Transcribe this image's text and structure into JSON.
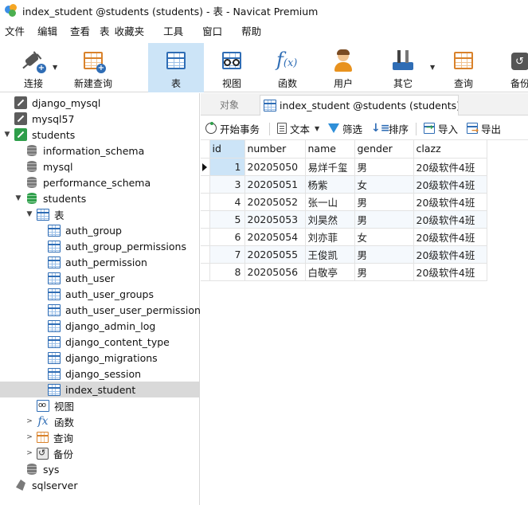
{
  "window": {
    "title": "index_student @students (students) - 表 - Navicat Premium"
  },
  "menu": [
    "文件",
    "编辑",
    "查看",
    "表",
    "收藏夹",
    "工具",
    "窗口",
    "帮助"
  ],
  "toolbar": {
    "connect": "连接",
    "new_query": "新建查询",
    "table": "表",
    "view": "视图",
    "function": "函数",
    "user": "用户",
    "other": "其它",
    "query": "查询",
    "backup": "备份"
  },
  "tree": {
    "connections": [
      "django_mysql",
      "mysql57",
      "students"
    ],
    "databases": [
      "information_schema",
      "mysql",
      "performance_schema",
      "students"
    ],
    "tables_label": "表",
    "tables": [
      "auth_group",
      "auth_group_permissions",
      "auth_permission",
      "auth_user",
      "auth_user_groups",
      "auth_user_user_permissions",
      "django_admin_log",
      "django_content_type",
      "django_migrations",
      "django_session",
      "index_student"
    ],
    "view_label": "视图",
    "function_label": "函数",
    "query_label": "查询",
    "backup_label": "备份",
    "sys": "sys",
    "sqlserver": "sqlserver"
  },
  "tabs": {
    "objects": "对象",
    "active": "index_student @students (students) ..."
  },
  "subtoolbar": {
    "begin_tx": "开始事务",
    "text": "文本",
    "filter": "筛选",
    "sort": "排序",
    "import": "导入",
    "export": "导出"
  },
  "grid": {
    "columns": [
      "id",
      "number",
      "name",
      "gender",
      "clazz"
    ],
    "rows": [
      [
        "1",
        "20205050",
        "易烊千玺",
        "男",
        "20级软件4班"
      ],
      [
        "3",
        "20205051",
        "杨紫",
        "女",
        "20级软件4班"
      ],
      [
        "4",
        "20205052",
        "张一山",
        "男",
        "20级软件4班"
      ],
      [
        "5",
        "20205053",
        "刘昊然",
        "男",
        "20级软件4班"
      ],
      [
        "6",
        "20205054",
        "刘亦菲",
        "女",
        "20级软件4班"
      ],
      [
        "7",
        "20205055",
        "王俊凯",
        "男",
        "20级软件4班"
      ],
      [
        "8",
        "20205056",
        "白敬亭",
        "男",
        "20级软件4班"
      ]
    ]
  },
  "colors": {
    "accent": "#cce4f7",
    "table_blue": "#2f6db5",
    "db_green": "#2e9e4a"
  }
}
